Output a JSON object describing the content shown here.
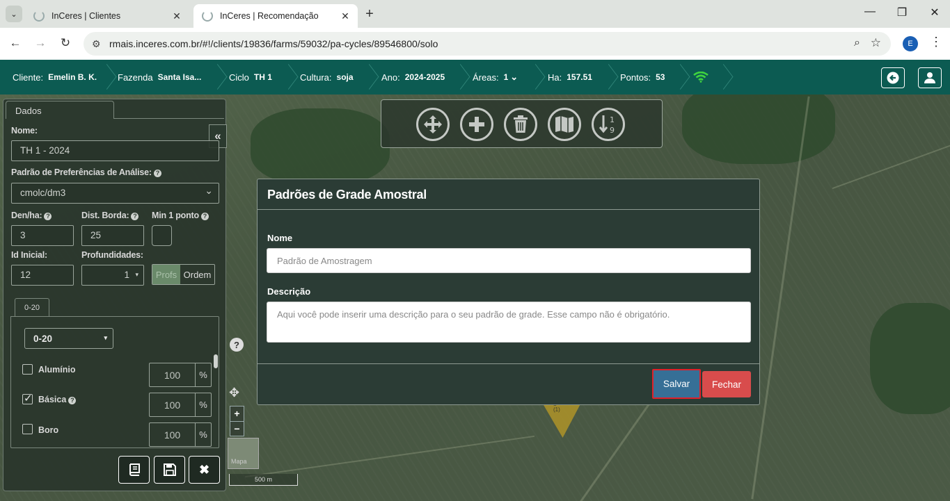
{
  "browser": {
    "tabs": [
      {
        "title": "InCeres | Clientes"
      },
      {
        "title": "InCeres | Recomendação"
      }
    ],
    "url": "rmais.inceres.com.br/#!/clients/19836/farms/59032/pa-cycles/89546800/solo",
    "profile_initial": "E"
  },
  "header": {
    "client_label": "Cliente:",
    "client_value": "Emelin B. K.",
    "farm_label": "Fazenda",
    "farm_value": "Santa Isa...",
    "cycle_label": "Ciclo",
    "cycle_value": "TH 1",
    "crop_label": "Cultura:",
    "crop_value": "soja",
    "year_label": "Ano:",
    "year_value": "2024-2025",
    "areas_label": "Áreas:",
    "areas_value": "1",
    "ha_label": "Ha:",
    "ha_value": "157.51",
    "points_label": "Pontos:",
    "points_value": "53"
  },
  "panel": {
    "tab_label": "Dados",
    "name_label": "Nome:",
    "name_value": "TH 1 - 2024",
    "pref_label": "Padrão de Preferências de Análise:",
    "pref_value": "cmolc/dm3",
    "den_label": "Den/ha:",
    "den_value": "3",
    "border_label": "Dist. Borda:",
    "border_value": "25",
    "min_label": "Min 1 ponto",
    "id_label": "Id Inicial:",
    "id_value": "12",
    "depths_label": "Profundidades:",
    "depths_value": "1",
    "profs_label": "Profs",
    "order_label": "Ordem",
    "subtab_label": "0-20",
    "depth_select": "0-20",
    "items": [
      {
        "label": "Alumínio",
        "value": "100",
        "unit": "%",
        "checked": false
      },
      {
        "label": "Básica",
        "value": "100",
        "unit": "%",
        "checked": true
      },
      {
        "label": "Boro",
        "value": "100",
        "unit": "%",
        "checked": false
      }
    ]
  },
  "map": {
    "minimap_label": "Mapa",
    "scale_label": "500 m",
    "help_symbol": "?",
    "zoom_in": "+",
    "zoom_out": "−",
    "plot_text": "ɑ\n(1)"
  },
  "modal": {
    "title": "Padrões de Grade Amostral",
    "name_label": "Nome",
    "name_placeholder": "Padrão de Amostragem",
    "desc_label": "Descrição",
    "desc_placeholder": "Aqui você pode inserir uma descrição para o seu padrão de grade. Esse campo não é obrigatório.",
    "save_label": "Salvar",
    "close_label": "Fechar"
  }
}
